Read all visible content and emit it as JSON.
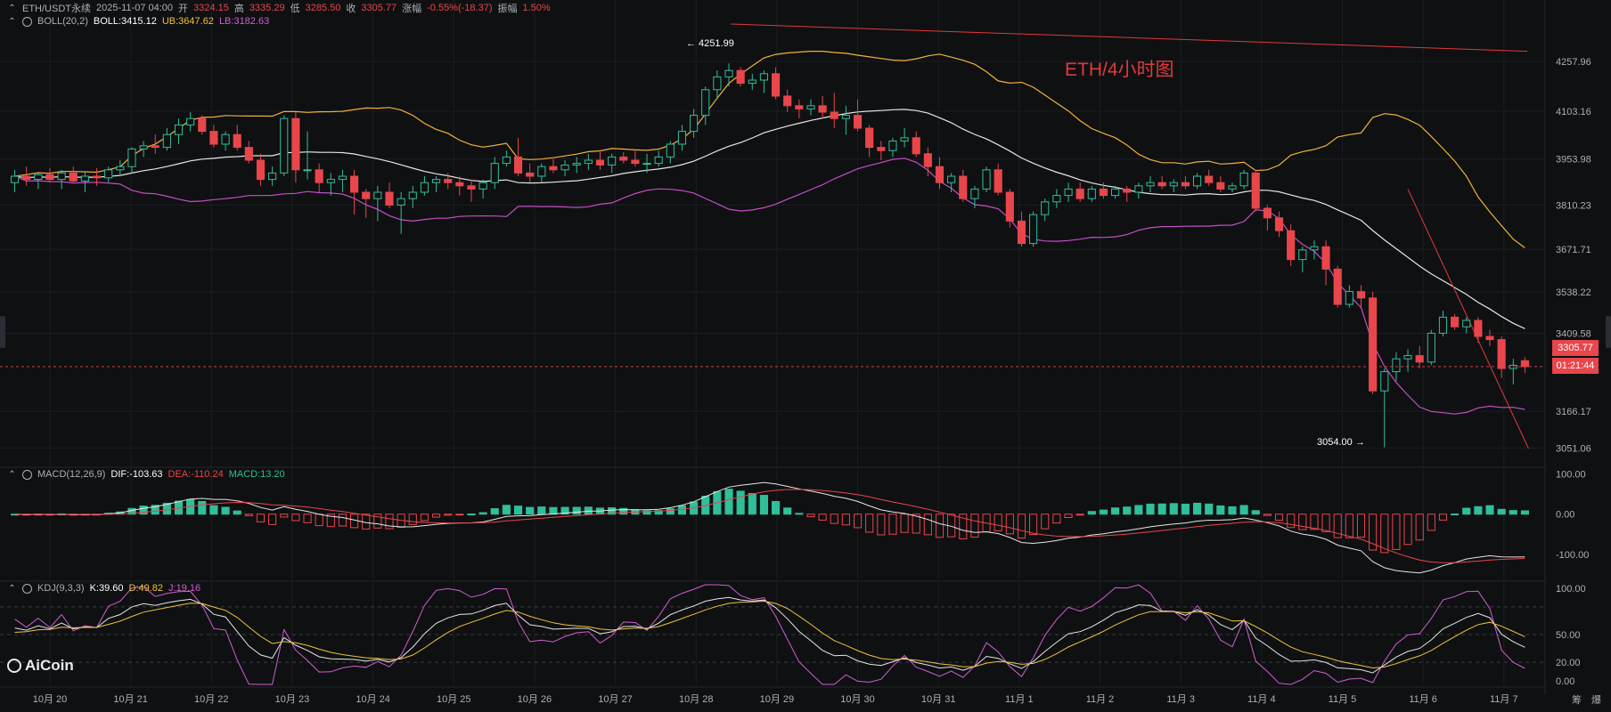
{
  "header": {
    "symbol": "ETH/USDT永续",
    "datetime": "2025-11-07 04:00",
    "open_label": "开",
    "open": "3324.15",
    "high_label": "高",
    "high": "3335.29",
    "low_label": "低",
    "low": "3285.50",
    "close_label": "收",
    "close": "3305.77",
    "change_label": "涨幅",
    "change": "-0.55%(-18.37)",
    "amp_label": "振幅",
    "amp": "1.50%"
  },
  "boll": {
    "label": "BOLL(20,2)",
    "mid": "BOLL:3415.12",
    "ub": "UB:3647.62",
    "lb": "LB:3182.63"
  },
  "macd": {
    "label": "MACD(12,26,9)",
    "dif": "DIF:-103.63",
    "dea": "DEA:-110.24",
    "macd": "MACD:13.20"
  },
  "kdj": {
    "label": "KDJ(9,3,3)",
    "k": "K:39.60",
    "d": "D:49.82",
    "j": "J:19.16"
  },
  "annotations": {
    "title": "ETH/4小时图",
    "high_marker": "← 4251.99",
    "low_marker": "3054.00 →"
  },
  "current": {
    "price": "3305.77",
    "countdown": "01:21:44"
  },
  "corner_labels": [
    "筹",
    "爆"
  ],
  "logo": "AiCoin",
  "colors": {
    "up": "#2fbf9a",
    "down": "#e8464b",
    "ub": "#f0b23a",
    "mid": "#e6e6e6",
    "lb": "#c34fc3",
    "dif": "#e6e6e6",
    "dea": "#e8464b",
    "k": "#e6e6e6",
    "d": "#f0c23a",
    "j": "#d05fd0",
    "trend": "#e03a3a"
  },
  "chart_data": [
    {
      "type": "candlestick",
      "title": "ETH/4小时图",
      "x_ticks": [
        "10月 20",
        "10月 21",
        "10月 22",
        "10月 23",
        "10月 24",
        "10月 25",
        "10月 26",
        "10月 27",
        "10月 28",
        "10月 29",
        "10月 30",
        "10月 31",
        "11月 1",
        "11月 2",
        "11月 3",
        "11月 4",
        "11月 5",
        "11月 6",
        "11月 7"
      ],
      "y_ticks": [
        "4257.96",
        "4103.16",
        "3953.98",
        "3810.23",
        "3671.71",
        "3538.22",
        "3409.58",
        "3166.17",
        "3051.06"
      ],
      "ylim": [
        3000,
        4350
      ],
      "candles": [
        [
          3880,
          3920,
          3850,
          3900
        ],
        [
          3900,
          3930,
          3870,
          3890
        ],
        [
          3890,
          3910,
          3860,
          3905
        ],
        [
          3905,
          3925,
          3880,
          3890
        ],
        [
          3890,
          3920,
          3860,
          3910
        ],
        [
          3910,
          3930,
          3880,
          3885
        ],
        [
          3885,
          3915,
          3850,
          3900
        ],
        [
          3900,
          3925,
          3870,
          3895
        ],
        [
          3895,
          3930,
          3880,
          3920
        ],
        [
          3920,
          3950,
          3900,
          3930
        ],
        [
          3930,
          3990,
          3910,
          3985
        ],
        [
          3985,
          4010,
          3960,
          3995
        ],
        [
          3995,
          4030,
          3970,
          3990
        ],
        [
          3990,
          4050,
          3980,
          4030
        ],
        [
          4030,
          4080,
          4000,
          4060
        ],
        [
          4060,
          4100,
          4040,
          4080
        ],
        [
          4080,
          4090,
          4030,
          4040
        ],
        [
          4040,
          4060,
          3990,
          4000
        ],
        [
          4000,
          4040,
          3980,
          4030
        ],
        [
          4030,
          4060,
          3980,
          3990
        ],
        [
          3990,
          4010,
          3940,
          3950
        ],
        [
          3950,
          3970,
          3870,
          3890
        ],
        [
          3890,
          3930,
          3870,
          3910
        ],
        [
          3910,
          4090,
          3900,
          4080
        ],
        [
          4080,
          4100,
          3880,
          3920
        ],
        [
          3920,
          4040,
          3890,
          3920
        ],
        [
          3920,
          3940,
          3850,
          3880
        ],
        [
          3880,
          3910,
          3840,
          3890
        ],
        [
          3890,
          3920,
          3850,
          3900
        ],
        [
          3900,
          3920,
          3780,
          3850
        ],
        [
          3850,
          3860,
          3770,
          3830
        ],
        [
          3830,
          3870,
          3760,
          3850
        ],
        [
          3850,
          3880,
          3800,
          3810
        ],
        [
          3810,
          3850,
          3720,
          3830
        ],
        [
          3830,
          3870,
          3800,
          3850
        ],
        [
          3850,
          3900,
          3840,
          3880
        ],
        [
          3880,
          3900,
          3850,
          3890
        ],
        [
          3890,
          3910,
          3860,
          3880
        ],
        [
          3880,
          3900,
          3840,
          3870
        ],
        [
          3870,
          3890,
          3820,
          3860
        ],
        [
          3860,
          3890,
          3830,
          3880
        ],
        [
          3880,
          3960,
          3860,
          3940
        ],
        [
          3940,
          3980,
          3930,
          3960
        ],
        [
          3960,
          4020,
          3900,
          3910
        ],
        [
          3910,
          3940,
          3880,
          3900
        ],
        [
          3900,
          3940,
          3880,
          3930
        ],
        [
          3930,
          3960,
          3910,
          3920
        ],
        [
          3920,
          3950,
          3900,
          3935
        ],
        [
          3935,
          3960,
          3910,
          3940
        ],
        [
          3940,
          3970,
          3920,
          3950
        ],
        [
          3950,
          3980,
          3920,
          3935
        ],
        [
          3935,
          3970,
          3910,
          3960
        ],
        [
          3960,
          3975,
          3940,
          3950
        ],
        [
          3950,
          3980,
          3930,
          3940
        ],
        [
          3940,
          3970,
          3910,
          3940
        ],
        [
          3940,
          3980,
          3930,
          3960
        ],
        [
          3960,
          4010,
          3940,
          4000
        ],
        [
          4000,
          4060,
          3980,
          4040
        ],
        [
          4040,
          4110,
          4020,
          4090
        ],
        [
          4090,
          4180,
          4060,
          4170
        ],
        [
          4170,
          4230,
          4140,
          4210
        ],
        [
          4210,
          4252,
          4180,
          4230
        ],
        [
          4230,
          4240,
          4180,
          4190
        ],
        [
          4190,
          4220,
          4170,
          4200
        ],
        [
          4200,
          4230,
          4160,
          4220
        ],
        [
          4220,
          4240,
          4140,
          4150
        ],
        [
          4150,
          4170,
          4100,
          4120
        ],
        [
          4120,
          4140,
          4080,
          4110
        ],
        [
          4110,
          4140,
          4090,
          4120
        ],
        [
          4120,
          4150,
          4080,
          4100
        ],
        [
          4100,
          4160,
          4050,
          4080
        ],
        [
          4080,
          4120,
          4030,
          4090
        ],
        [
          4090,
          4140,
          4040,
          4050
        ],
        [
          4050,
          4060,
          3960,
          3990
        ],
        [
          3990,
          4010,
          3950,
          3980
        ],
        [
          3980,
          4020,
          3960,
          4010
        ],
        [
          4010,
          4050,
          3990,
          4020
        ],
        [
          4020,
          4040,
          3960,
          3970
        ],
        [
          3970,
          3990,
          3900,
          3930
        ],
        [
          3930,
          3960,
          3860,
          3880
        ],
        [
          3880,
          3910,
          3850,
          3900
        ],
        [
          3900,
          3920,
          3820,
          3830
        ],
        [
          3830,
          3870,
          3800,
          3860
        ],
        [
          3860,
          3930,
          3850,
          3920
        ],
        [
          3920,
          3940,
          3840,
          3850
        ],
        [
          3850,
          3860,
          3740,
          3760
        ],
        [
          3760,
          3790,
          3680,
          3690
        ],
        [
          3690,
          3790,
          3680,
          3780
        ],
        [
          3780,
          3830,
          3760,
          3820
        ],
        [
          3820,
          3860,
          3800,
          3840
        ],
        [
          3840,
          3880,
          3820,
          3860
        ],
        [
          3860,
          3880,
          3820,
          3830
        ],
        [
          3830,
          3870,
          3820,
          3860
        ],
        [
          3860,
          3880,
          3830,
          3840
        ],
        [
          3840,
          3870,
          3830,
          3860
        ],
        [
          3860,
          3870,
          3820,
          3850
        ],
        [
          3850,
          3880,
          3830,
          3870
        ],
        [
          3870,
          3900,
          3850,
          3880
        ],
        [
          3880,
          3900,
          3860,
          3870
        ],
        [
          3870,
          3890,
          3850,
          3880
        ],
        [
          3880,
          3900,
          3860,
          3870
        ],
        [
          3870,
          3910,
          3860,
          3900
        ],
        [
          3900,
          3920,
          3870,
          3880
        ],
        [
          3880,
          3900,
          3850,
          3860
        ],
        [
          3860,
          3880,
          3850,
          3870
        ],
        [
          3870,
          3920,
          3860,
          3910
        ],
        [
          3910,
          3920,
          3790,
          3800
        ],
        [
          3800,
          3810,
          3730,
          3770
        ],
        [
          3770,
          3790,
          3710,
          3730
        ],
        [
          3730,
          3750,
          3620,
          3640
        ],
        [
          3640,
          3680,
          3600,
          3670
        ],
        [
          3670,
          3700,
          3640,
          3680
        ],
        [
          3680,
          3700,
          3560,
          3610
        ],
        [
          3610,
          3620,
          3490,
          3500
        ],
        [
          3500,
          3560,
          3490,
          3540
        ],
        [
          3540,
          3560,
          3490,
          3520
        ],
        [
          3520,
          3540,
          3220,
          3230
        ],
        [
          3230,
          3300,
          3054,
          3290
        ],
        [
          3290,
          3350,
          3260,
          3330
        ],
        [
          3330,
          3360,
          3290,
          3340
        ],
        [
          3340,
          3370,
          3300,
          3320
        ],
        [
          3320,
          3420,
          3310,
          3410
        ],
        [
          3410,
          3480,
          3400,
          3460
        ],
        [
          3460,
          3470,
          3420,
          3430
        ],
        [
          3430,
          3460,
          3410,
          3450
        ],
        [
          3450,
          3460,
          3380,
          3400
        ],
        [
          3400,
          3420,
          3370,
          3390
        ],
        [
          3390,
          3400,
          3270,
          3300
        ],
        [
          3300,
          3330,
          3250,
          3310
        ],
        [
          3324.15,
          3335.29,
          3285.5,
          3305.77
        ]
      ],
      "bollinger": {
        "period": 20,
        "mult": 2
      }
    },
    {
      "type": "bar",
      "title": "MACD(12,26,9)",
      "y_ticks": [
        "100.00",
        "0.00",
        "-100.00"
      ],
      "ylim": [
        -160,
        110
      ]
    },
    {
      "type": "line",
      "title": "KDJ(9,3,3)",
      "y_ticks": [
        "100.00",
        "50.00",
        "20.00",
        "0.00"
      ],
      "ylim": [
        -5,
        105
      ]
    }
  ]
}
